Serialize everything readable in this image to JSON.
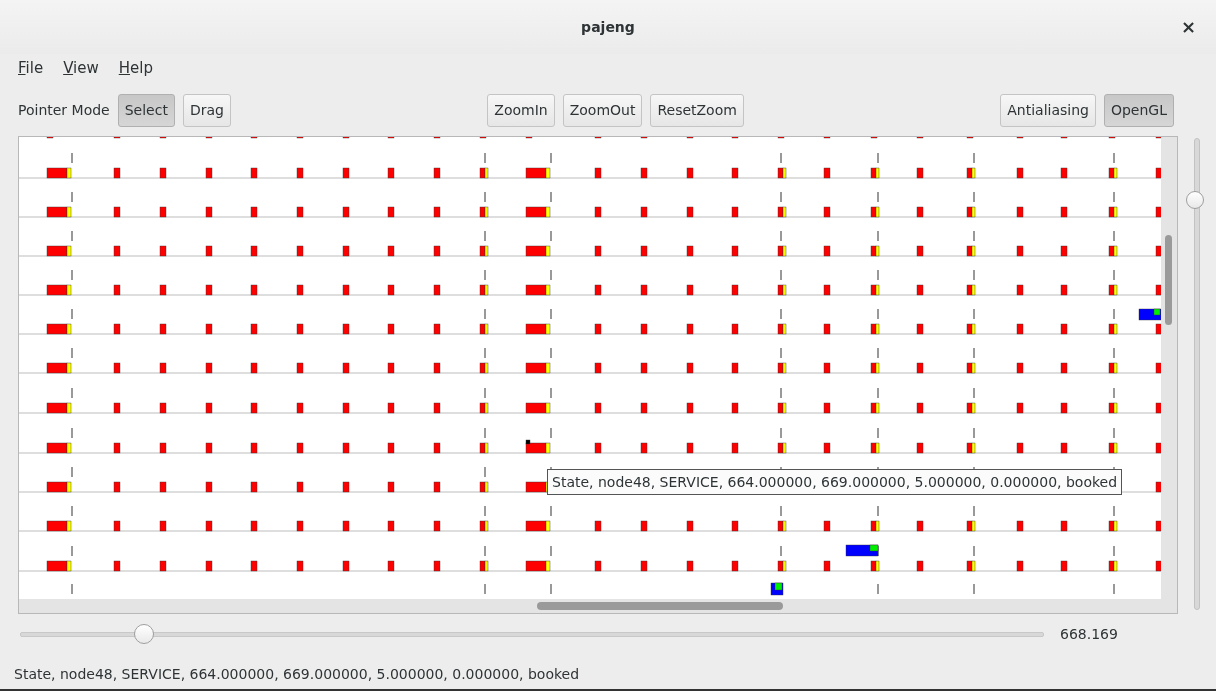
{
  "window": {
    "title": "pajeng",
    "close": "×"
  },
  "menu": [
    {
      "label": "File"
    },
    {
      "label": "View"
    },
    {
      "label": "Help"
    }
  ],
  "toolbar": {
    "pointer_mode_label": "Pointer Mode",
    "modes": [
      {
        "label": "Select",
        "selected": true
      },
      {
        "label": "Drag",
        "selected": false
      }
    ],
    "zoom_buttons": [
      "ZoomIn",
      "ZoomOut",
      "ResetZoom"
    ],
    "toggles": [
      {
        "label": "Antialiasing",
        "checked": false
      },
      {
        "label": "OpenGL",
        "checked": true
      }
    ]
  },
  "time_slider": {
    "level": 0.12,
    "reading": "668.169"
  },
  "tooltip": "State, node48, SERVICE, 664.000000, 669.000000, 5.000000, 0.000000, booked",
  "status_bar": "State, node48, SERVICE, 664.000000, 669.000000, 5.000000, 0.000000, booked"
}
